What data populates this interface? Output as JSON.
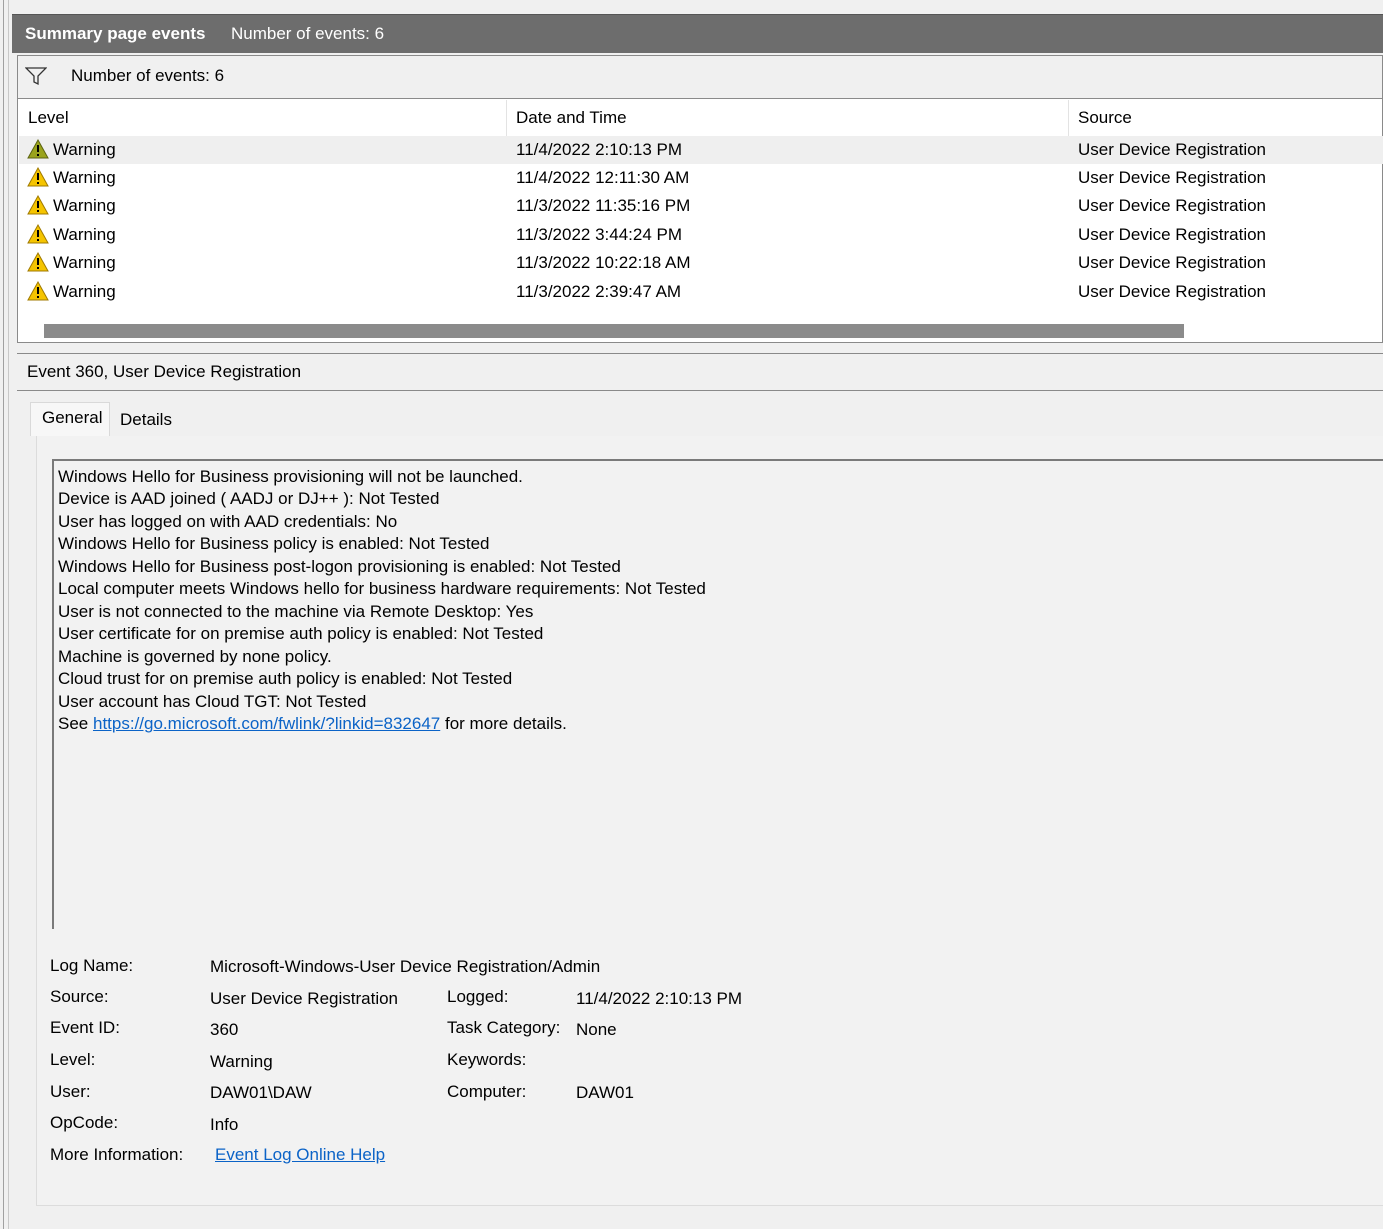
{
  "summary": {
    "title": "Summary page events",
    "count_label": "Number of events: 6"
  },
  "filter": {
    "icon": "filter-icon",
    "count_label": "Number of events: 6"
  },
  "table": {
    "columns": [
      "Level",
      "Date and Time",
      "Source"
    ],
    "rows": [
      {
        "level": "Warning",
        "datetime": "11/4/2022 2:10:13 PM",
        "source": "User Device Registration",
        "icon": "warning-icon"
      },
      {
        "level": "Warning",
        "datetime": "11/4/2022 12:11:30 AM",
        "source": "User Device Registration",
        "icon": "warning-icon"
      },
      {
        "level": "Warning",
        "datetime": "11/3/2022 11:35:16 PM",
        "source": "User Device Registration",
        "icon": "warning-icon"
      },
      {
        "level": "Warning",
        "datetime": "11/3/2022 3:44:24 PM",
        "source": "User Device Registration",
        "icon": "warning-icon"
      },
      {
        "level": "Warning",
        "datetime": "11/3/2022 10:22:18 AM",
        "source": "User Device Registration",
        "icon": "warning-icon"
      },
      {
        "level": "Warning",
        "datetime": "11/3/2022 2:39:47 AM",
        "source": "User Device Registration",
        "icon": "warning-icon"
      }
    ]
  },
  "detail": {
    "title": "Event 360, User Device Registration",
    "tabs": [
      "General",
      "Details"
    ],
    "message_lines": [
      "Windows Hello for Business provisioning will not be launched.",
      "Device is AAD joined ( AADJ or DJ++ ): Not Tested",
      "User has logged on with AAD credentials: No",
      "Windows Hello for Business policy is enabled: Not Tested",
      "Windows Hello for Business post-logon provisioning is enabled: Not Tested",
      "Local computer meets Windows hello for business hardware requirements: Not Tested",
      "User is not connected to the machine via Remote Desktop: Yes",
      "User certificate for on premise auth policy is enabled: Not Tested",
      "Machine is governed by none policy.",
      "Cloud trust for on premise auth policy is enabled: Not Tested",
      "User account has Cloud TGT: Not Tested"
    ],
    "see_prefix": "See ",
    "see_link": "https://go.microsoft.com/fwlink/?linkid=832647",
    "see_suffix": " for more details.",
    "meta": {
      "log_name_label": "Log Name:",
      "log_name": "Microsoft-Windows-User Device Registration/Admin",
      "source_label": "Source:",
      "source": "User Device Registration",
      "logged_label": "Logged:",
      "logged": "11/4/2022 2:10:13 PM",
      "event_id_label": "Event ID:",
      "event_id": "360",
      "task_category_label": "Task Category:",
      "task_category": "None",
      "level_label": "Level:",
      "level": "Warning",
      "keywords_label": "Keywords:",
      "keywords": "",
      "user_label": "User:",
      "user": "DAW01\\DAW",
      "computer_label": "Computer:",
      "computer": "DAW01",
      "opcode_label": "OpCode:",
      "opcode": "Info",
      "more_info_label": "More Information:",
      "more_info_link": "Event Log Online Help"
    }
  }
}
